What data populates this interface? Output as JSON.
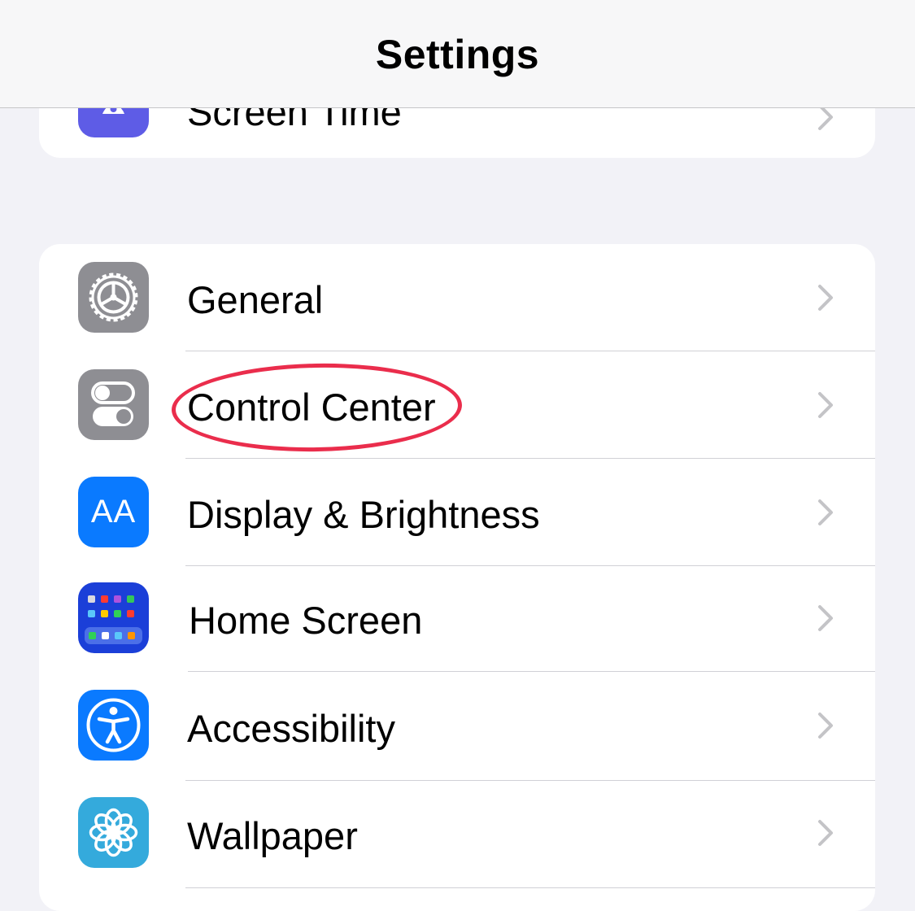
{
  "header": {
    "title": "Settings"
  },
  "top_group": {
    "item": {
      "label": "Screen Time",
      "icon": "hourglass-icon",
      "icon_color": "#5e5ce6"
    }
  },
  "main_group": {
    "items": [
      {
        "label": "General",
        "icon": "gear-icon",
        "icon_color": "#8e8e93"
      },
      {
        "label": "Control Center",
        "icon": "toggles-icon",
        "icon_color": "#8e8e93"
      },
      {
        "label": "Display & Brightness",
        "icon": "text-size-icon",
        "icon_color": "#0a7aff"
      },
      {
        "label": "Home Screen",
        "icon": "app-grid-icon",
        "icon_color": "#1b3fd8"
      },
      {
        "label": "Accessibility",
        "icon": "accessibility-icon",
        "icon_color": "#0a7aff"
      },
      {
        "label": "Wallpaper",
        "icon": "flower-icon",
        "icon_color": "#34aadc"
      }
    ]
  },
  "annotation": {
    "highlight_color": "#ea2d4c",
    "highlighted_item": "Control Center"
  },
  "display_icon_text": "AA"
}
